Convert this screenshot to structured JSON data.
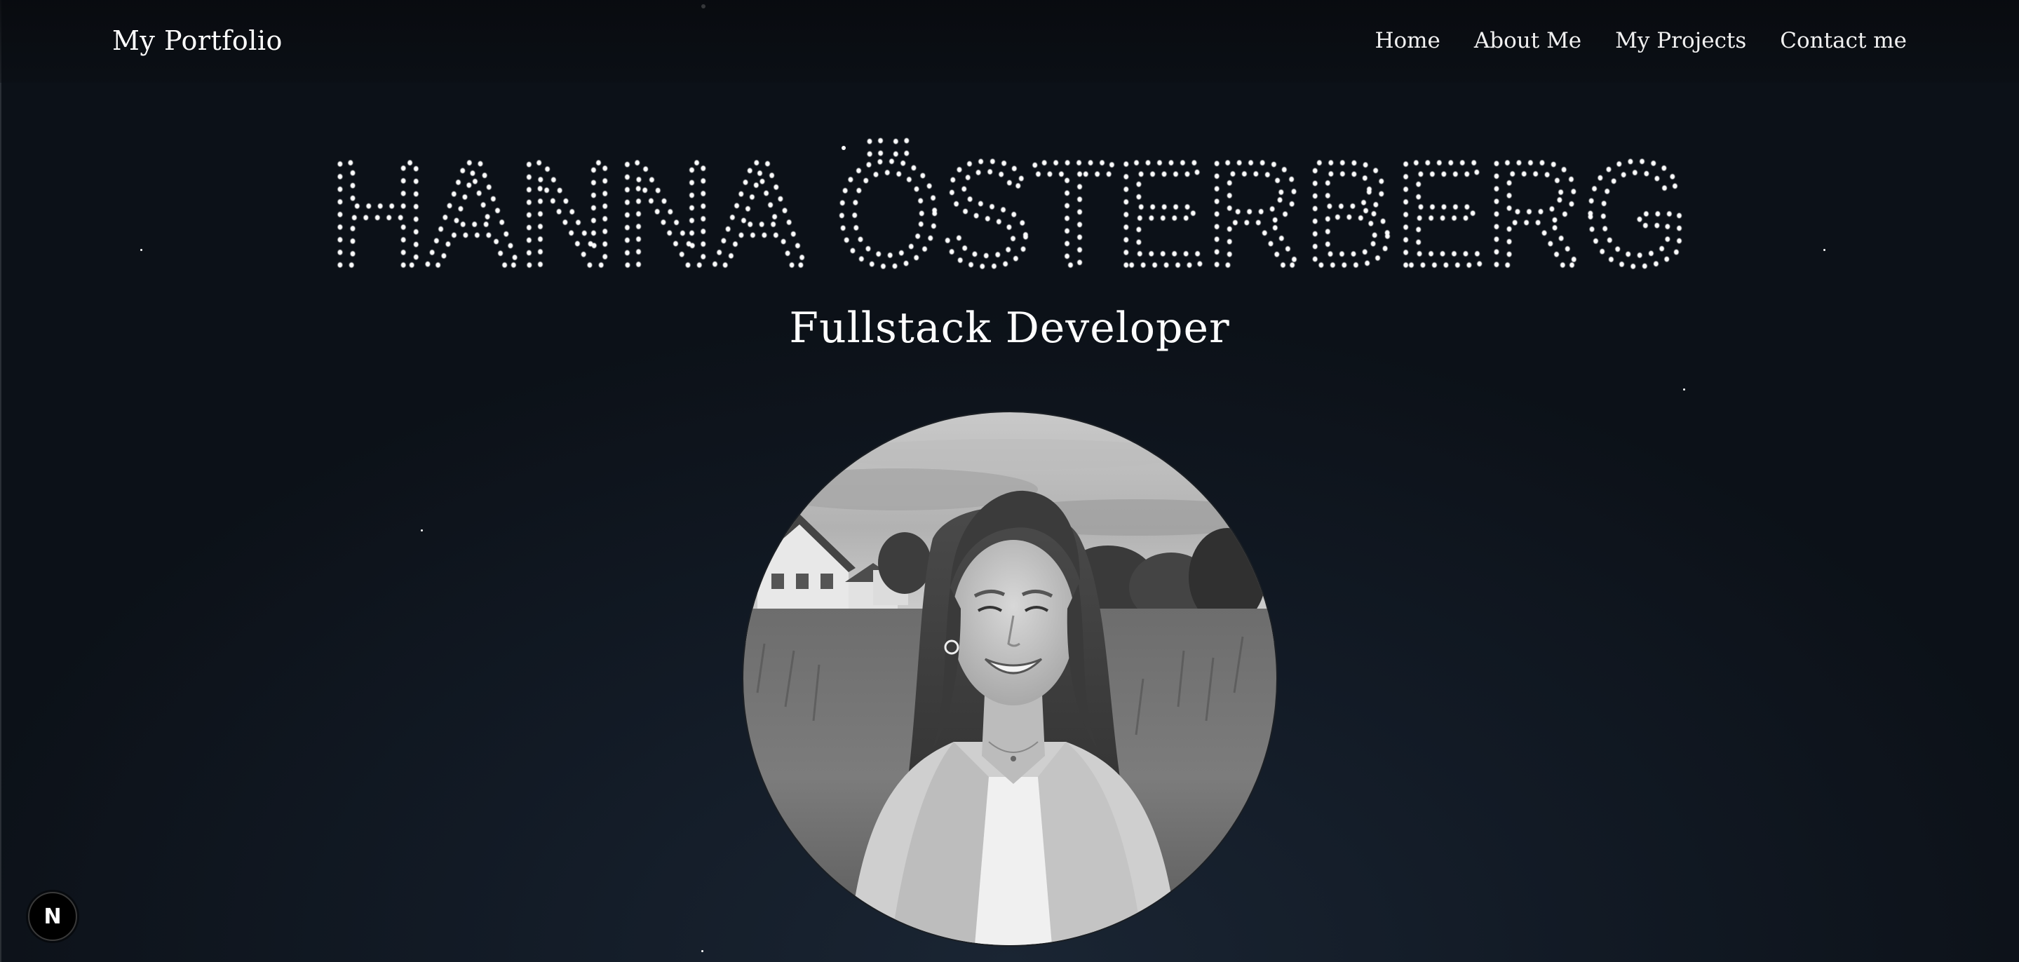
{
  "header": {
    "logo": "My Portfolio",
    "nav": [
      {
        "label": "Home"
      },
      {
        "label": "About Me"
      },
      {
        "label": "My Projects"
      },
      {
        "label": "Contact me"
      }
    ]
  },
  "hero": {
    "name": "HANNA ÖSTERBERG",
    "subtitle": "Fullstack Developer"
  },
  "dev_badge": {
    "letter": "N"
  },
  "colors": {
    "background": "#0c1118",
    "text": "#ffffff"
  }
}
